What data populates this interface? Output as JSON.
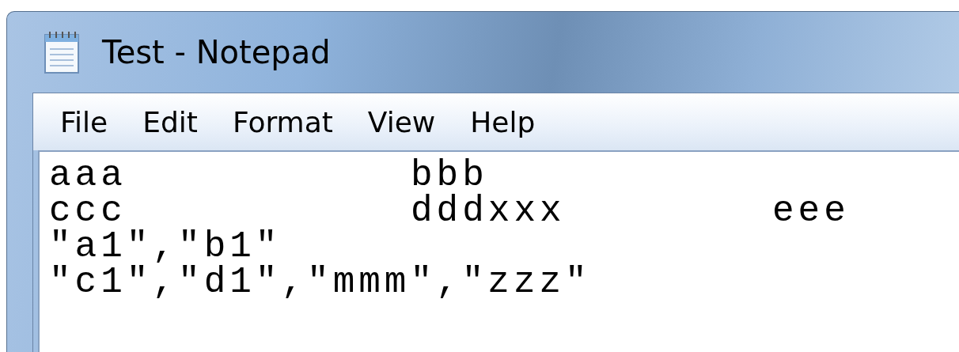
{
  "window": {
    "title": "Test - Notepad"
  },
  "menu": [
    "File",
    "Edit",
    "Format",
    "View",
    "Help"
  ],
  "editor": {
    "lines": [
      "aaa\tbbb",
      "ccc\tdddxxx\teee",
      "\"a1\",\"b1\"",
      "\"c1\",\"d1\",\"mmm\",\"zzz\""
    ]
  }
}
